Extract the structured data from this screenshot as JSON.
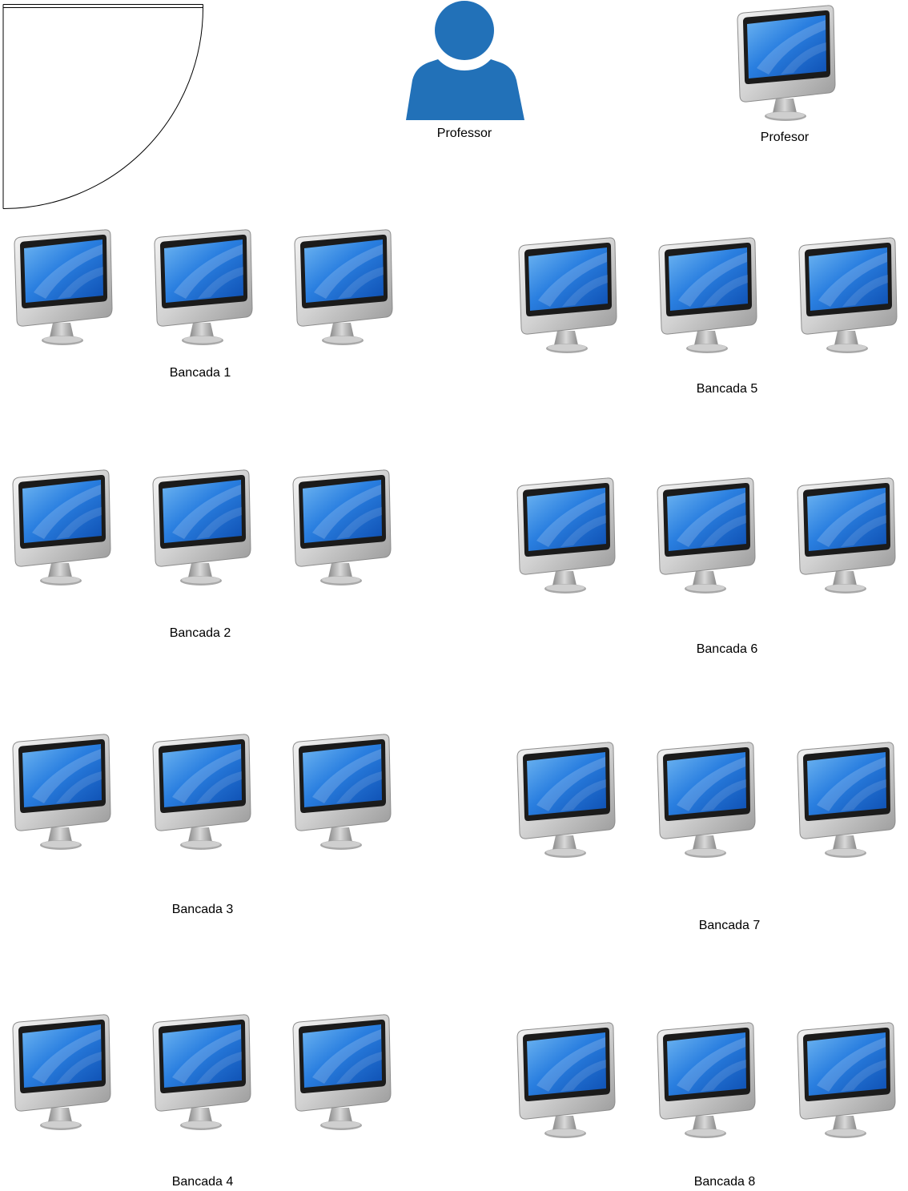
{
  "professor": {
    "label": "Professor"
  },
  "teacher_computer": {
    "label": "Profesor"
  },
  "benches": [
    {
      "label": "Bancada 1",
      "computers": 3
    },
    {
      "label": "Bancada 2",
      "computers": 3
    },
    {
      "label": "Bancada 3",
      "computers": 3
    },
    {
      "label": "Bancada 4",
      "computers": 3
    },
    {
      "label": "Bancada 5",
      "computers": 3
    },
    {
      "label": "Bancada 6",
      "computers": 3
    },
    {
      "label": "Bancada 7",
      "computers": 3
    },
    {
      "label": "Bancada 8",
      "computers": 3
    }
  ],
  "colors": {
    "person": "#2271b8",
    "screen": "#1f6fd1",
    "frame": "#c8c8c8"
  },
  "icons": {
    "person": "user-icon",
    "computer": "imac-icon",
    "door": "door-swing-icon"
  }
}
